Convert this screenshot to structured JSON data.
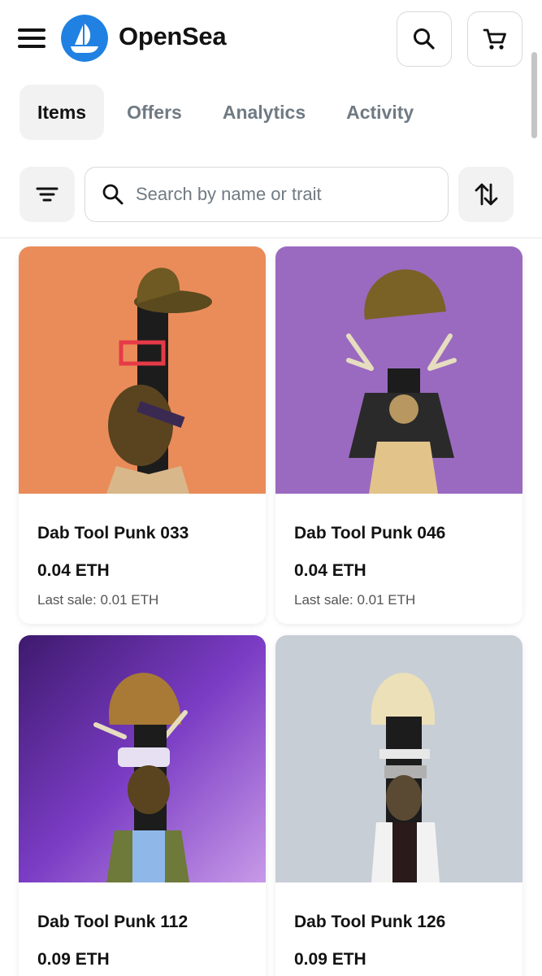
{
  "header": {
    "brand_name": "OpenSea",
    "brand_color": "#2081e2",
    "menu_icon": "hamburger-menu-icon",
    "search_icon": "search-icon",
    "cart_icon": "cart-icon"
  },
  "tabs": [
    {
      "label": "Items",
      "active": true
    },
    {
      "label": "Offers",
      "active": false
    },
    {
      "label": "Analytics",
      "active": false
    },
    {
      "label": "Activity",
      "active": false
    }
  ],
  "filters": {
    "search_placeholder": "Search by name or trait",
    "search_value": "",
    "filter_icon": "filter-icon",
    "sort_icon": "sort-icon"
  },
  "items": [
    {
      "name": "Dab Tool Punk 033",
      "price": "0.04 ETH",
      "last_sale": "Last sale: 0.01 ETH",
      "background": "#ea8c5a"
    },
    {
      "name": "Dab Tool Punk 046",
      "price": "0.04 ETH",
      "last_sale": "Last sale: 0.01 ETH",
      "background": "#9a6ac0"
    },
    {
      "name": "Dab Tool Punk 112",
      "price": "0.09 ETH",
      "last_sale": "",
      "background": "#5a2a8e"
    },
    {
      "name": "Dab Tool Punk 126",
      "price": "0.09 ETH",
      "last_sale": "",
      "background": "#c8ced6"
    }
  ]
}
